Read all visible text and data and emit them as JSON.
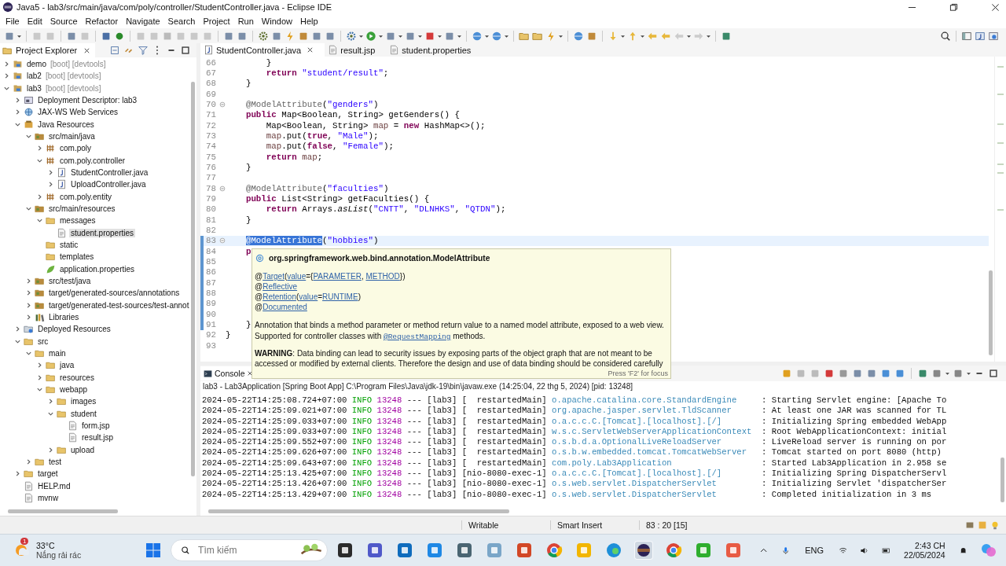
{
  "window": {
    "title": "Java5 - lab3/src/main/java/com/poly/controller/StudentController.java - Eclipse IDE"
  },
  "menu": [
    "File",
    "Edit",
    "Source",
    "Refactor",
    "Navigate",
    "Search",
    "Project",
    "Run",
    "Window",
    "Help"
  ],
  "project_explorer": {
    "title": "Project Explorer",
    "tree": [
      {
        "label": "demo",
        "suffix": "[boot] [devtools]",
        "kind": "project",
        "expanded": false,
        "selected": false
      },
      {
        "label": "lab2",
        "suffix": "[boot] [devtools]",
        "kind": "project",
        "expanded": false,
        "selected": false
      },
      {
        "label": "lab3",
        "suffix": "[boot] [devtools]",
        "kind": "project",
        "expanded": true,
        "selected": false,
        "children": [
          {
            "label": "Deployment Descriptor: lab3",
            "kind": "descriptor",
            "expanded": false,
            "selected": false
          },
          {
            "label": "JAX-WS Web Services",
            "kind": "webservice",
            "expanded": false,
            "selected": false
          },
          {
            "label": "Java Resources",
            "kind": "javares",
            "expanded": true,
            "selected": false,
            "children": [
              {
                "label": "src/main/java",
                "kind": "srcfolder",
                "expanded": true,
                "selected": false,
                "children": [
                  {
                    "label": "com.poly",
                    "kind": "package",
                    "expanded": false,
                    "selected": false
                  },
                  {
                    "label": "com.poly.controller",
                    "kind": "package",
                    "expanded": true,
                    "selected": false,
                    "children": [
                      {
                        "label": "StudentController.java",
                        "kind": "javafile",
                        "expanded": false,
                        "selected": false
                      },
                      {
                        "label": "UploadController.java",
                        "kind": "javafile",
                        "expanded": false,
                        "selected": false
                      }
                    ]
                  },
                  {
                    "label": "com.poly.entity",
                    "kind": "package",
                    "expanded": false,
                    "selected": false
                  }
                ]
              },
              {
                "label": "src/main/resources",
                "kind": "srcfolder",
                "expanded": true,
                "selected": false,
                "children": [
                  {
                    "label": "messages",
                    "kind": "folder",
                    "expanded": true,
                    "selected": false,
                    "children": [
                      {
                        "label": "student.properties",
                        "kind": "file",
                        "selected": true
                      }
                    ]
                  },
                  {
                    "label": "static",
                    "kind": "folder",
                    "selected": false
                  },
                  {
                    "label": "templates",
                    "kind": "folder",
                    "selected": false
                  },
                  {
                    "label": "application.properties",
                    "kind": "spring",
                    "selected": false
                  }
                ]
              },
              {
                "label": "src/test/java",
                "kind": "srcfolder",
                "expanded": false,
                "selected": false
              },
              {
                "label": "target/generated-sources/annotations",
                "kind": "srcfolder",
                "expanded": false,
                "selected": false
              },
              {
                "label": "target/generated-test-sources/test-annot",
                "kind": "srcfolder",
                "expanded": false,
                "selected": false
              },
              {
                "label": "Libraries",
                "kind": "library",
                "expanded": false,
                "selected": false
              }
            ]
          },
          {
            "label": "Deployed Resources",
            "kind": "deployed",
            "expanded": false,
            "selected": false
          },
          {
            "label": "src",
            "kind": "folder",
            "expanded": true,
            "selected": false,
            "children": [
              {
                "label": "main",
                "kind": "folder",
                "expanded": true,
                "selected": false,
                "children": [
                  {
                    "label": "java",
                    "kind": "folder",
                    "expanded": false,
                    "selected": false
                  },
                  {
                    "label": "resources",
                    "kind": "folder",
                    "expanded": false,
                    "selected": false
                  },
                  {
                    "label": "webapp",
                    "kind": "folder",
                    "expanded": true,
                    "selected": false,
                    "children": [
                      {
                        "label": "images",
                        "kind": "folder",
                        "expanded": false,
                        "selected": false
                      },
                      {
                        "label": "student",
                        "kind": "folder",
                        "expanded": true,
                        "selected": false,
                        "children": [
                          {
                            "label": "form.jsp",
                            "kind": "jsp",
                            "selected": false
                          },
                          {
                            "label": "result.jsp",
                            "kind": "jsp",
                            "selected": false
                          }
                        ]
                      },
                      {
                        "label": "upload",
                        "kind": "folder",
                        "expanded": false,
                        "selected": false
                      }
                    ]
                  }
                ]
              },
              {
                "label": "test",
                "kind": "folder",
                "expanded": false,
                "selected": false
              }
            ]
          },
          {
            "label": "target",
            "kind": "folder",
            "expanded": false,
            "selected": false
          },
          {
            "label": "HELP.md",
            "kind": "md",
            "selected": false
          },
          {
            "label": "mvnw",
            "kind": "file",
            "selected": false
          }
        ]
      }
    ]
  },
  "editor": {
    "tabs": [
      {
        "label": "StudentController.java",
        "kind": "javafile",
        "selected": true
      },
      {
        "label": "result.jsp",
        "kind": "jsp",
        "selected": false
      },
      {
        "label": "student.properties",
        "kind": "file",
        "selected": false
      }
    ],
    "lines": [
      {
        "number": "66",
        "kind": "body",
        "fold": false,
        "current": false,
        "in_range": false,
        "tokens": [
          {
            "kind": "plain",
            "text": "}"
          }
        ]
      },
      {
        "number": "67",
        "kind": "body",
        "fold": false,
        "current": false,
        "in_range": false,
        "tokens": [
          {
            "kind": "keyword",
            "text": "return "
          },
          {
            "kind": "string",
            "text": "\"student/result\""
          },
          {
            "kind": "plain",
            "text": ";"
          }
        ]
      },
      {
        "number": "68",
        "kind": "member",
        "fold": false,
        "current": false,
        "in_range": false,
        "tokens": [
          {
            "kind": "plain",
            "text": "}"
          }
        ]
      },
      {
        "number": "69",
        "fold": false,
        "current": false,
        "in_range": false
      },
      {
        "number": "70",
        "kind": "member",
        "fold": true,
        "current": false,
        "in_range": false,
        "tokens": [
          {
            "kind": "annotation",
            "text": "@ModelAttribute"
          },
          {
            "kind": "plain",
            "text": "("
          },
          {
            "kind": "string",
            "text": "\"genders\""
          },
          {
            "kind": "plain",
            "text": ")"
          }
        ]
      },
      {
        "number": "71",
        "kind": "member",
        "fold": false,
        "current": false,
        "in_range": false,
        "tokens": [
          {
            "kind": "keyword",
            "text": "public"
          },
          {
            "kind": "plain",
            "text": " Map<Boolean, String> getGenders() {"
          }
        ]
      },
      {
        "number": "72",
        "kind": "body",
        "fold": false,
        "current": false,
        "in_range": false,
        "tokens": [
          {
            "kind": "plain",
            "text": "Map<Boolean, String> "
          },
          {
            "kind": "variable",
            "text": "map"
          },
          {
            "kind": "plain",
            "text": " = "
          },
          {
            "kind": "keyword",
            "text": "new"
          },
          {
            "kind": "plain",
            "text": " HashMap<>();"
          }
        ]
      },
      {
        "number": "73",
        "kind": "body",
        "fold": false,
        "current": false,
        "in_range": false,
        "tokens": [
          {
            "kind": "variable",
            "text": "map"
          },
          {
            "kind": "plain",
            "text": ".put("
          },
          {
            "kind": "keyword",
            "text": "true"
          },
          {
            "kind": "plain",
            "text": ", "
          },
          {
            "kind": "string",
            "text": "\"Male\""
          },
          {
            "kind": "plain",
            "text": ");"
          }
        ]
      },
      {
        "number": "74",
        "kind": "body",
        "fold": false,
        "current": false,
        "in_range": false,
        "tokens": [
          {
            "kind": "variable",
            "text": "map"
          },
          {
            "kind": "plain",
            "text": ".put("
          },
          {
            "kind": "keyword",
            "text": "false"
          },
          {
            "kind": "plain",
            "text": ", "
          },
          {
            "kind": "string",
            "text": "\"Female\""
          },
          {
            "kind": "plain",
            "text": ");"
          }
        ]
      },
      {
        "number": "75",
        "kind": "body",
        "fold": false,
        "current": false,
        "in_range": false,
        "tokens": [
          {
            "kind": "keyword",
            "text": "return "
          },
          {
            "kind": "variable",
            "text": "map"
          },
          {
            "kind": "plain",
            "text": ";"
          }
        ]
      },
      {
        "number": "76",
        "kind": "member",
        "fold": false,
        "current": false,
        "in_range": false,
        "tokens": [
          {
            "kind": "plain",
            "text": "}"
          }
        ]
      },
      {
        "number": "77",
        "fold": false,
        "current": false,
        "in_range": false
      },
      {
        "number": "78",
        "kind": "member",
        "fold": true,
        "current": false,
        "in_range": false,
        "tokens": [
          {
            "kind": "annotation",
            "text": "@ModelAttribute"
          },
          {
            "kind": "plain",
            "text": "("
          },
          {
            "kind": "string",
            "text": "\"faculties\""
          },
          {
            "kind": "plain",
            "text": ")"
          }
        ]
      },
      {
        "number": "79",
        "kind": "member",
        "fold": false,
        "current": false,
        "in_range": false,
        "tokens": [
          {
            "kind": "keyword",
            "text": "public"
          },
          {
            "kind": "plain",
            "text": " List<String> getFaculties() {"
          }
        ]
      },
      {
        "number": "80",
        "kind": "body",
        "fold": false,
        "current": false,
        "in_range": false,
        "tokens": [
          {
            "kind": "keyword",
            "text": "return "
          },
          {
            "kind": "plain",
            "text": "Arrays."
          },
          {
            "kind": "static",
            "text": "asList"
          },
          {
            "kind": "plain",
            "text": "("
          },
          {
            "kind": "string",
            "text": "\"CNTT\""
          },
          {
            "kind": "plain",
            "text": ", "
          },
          {
            "kind": "string",
            "text": "\"DLNHKS\""
          },
          {
            "kind": "plain",
            "text": ", "
          },
          {
            "kind": "string",
            "text": "\"QTDN\""
          },
          {
            "kind": "plain",
            "text": ");"
          }
        ]
      },
      {
        "number": "81",
        "kind": "member",
        "fold": false,
        "current": false,
        "in_range": false,
        "tokens": [
          {
            "kind": "plain",
            "text": "}"
          }
        ]
      },
      {
        "number": "82",
        "fold": false,
        "current": false,
        "in_range": false
      },
      {
        "number": "83",
        "kind": "member",
        "fold": true,
        "current": true,
        "in_range": true,
        "tokens": [
          {
            "kind": "selection",
            "text": "@ModelAttribute"
          },
          {
            "kind": "plain",
            "text": "("
          },
          {
            "kind": "string",
            "text": "\"hobbies\""
          },
          {
            "kind": "plain",
            "text": ")"
          }
        ]
      },
      {
        "number": "84",
        "kind": "member",
        "fold": false,
        "current": false,
        "in_range": true,
        "tokens": [
          {
            "kind": "keyword",
            "text": "p"
          }
        ]
      },
      {
        "number": "85",
        "fold": false,
        "current": false,
        "in_range": true
      },
      {
        "number": "86",
        "fold": false,
        "current": false,
        "in_range": true
      },
      {
        "number": "87",
        "fold": false,
        "current": false,
        "in_range": true
      },
      {
        "number": "88",
        "fold": false,
        "current": false,
        "in_range": true
      },
      {
        "number": "89",
        "fold": false,
        "current": false,
        "in_range": true
      },
      {
        "number": "90",
        "fold": false,
        "current": false,
        "in_range": true
      },
      {
        "number": "91",
        "kind": "member",
        "fold": false,
        "current": false,
        "in_range": true,
        "tokens": [
          {
            "kind": "plain",
            "text": "}"
          }
        ]
      },
      {
        "number": "92",
        "kind": "top",
        "fold": false,
        "current": false,
        "in_range": false,
        "tokens": [
          {
            "kind": "plain",
            "text": "}"
          }
        ]
      },
      {
        "number": "93",
        "fold": false,
        "current": false,
        "in_range": false
      }
    ],
    "hover": {
      "title": "org.springframework.web.bind.annotation.ModelAttribute",
      "meta": [
        [
          {
            "kind": "text",
            "text": "@"
          },
          {
            "kind": "link",
            "text": "Target"
          },
          {
            "kind": "text",
            "text": "("
          },
          {
            "kind": "link",
            "text": "value"
          },
          {
            "kind": "text",
            "text": "={"
          },
          {
            "kind": "link",
            "text": "PARAMETER"
          },
          {
            "kind": "text",
            "text": ", "
          },
          {
            "kind": "link",
            "text": "METHOD"
          },
          {
            "kind": "text",
            "text": "})"
          }
        ],
        [
          {
            "kind": "text",
            "text": "@"
          },
          {
            "kind": "link",
            "text": "Reflective"
          }
        ],
        [
          {
            "kind": "text",
            "text": "@"
          },
          {
            "kind": "link",
            "text": "Retention"
          },
          {
            "kind": "text",
            "text": "("
          },
          {
            "kind": "link",
            "text": "value"
          },
          {
            "kind": "text",
            "text": "="
          },
          {
            "kind": "link",
            "text": "RUNTIME"
          },
          {
            "kind": "text",
            "text": ")"
          }
        ],
        [
          {
            "kind": "text",
            "text": "@"
          },
          {
            "kind": "link",
            "text": "Documented"
          }
        ]
      ],
      "description": [
        {
          "kind": "text",
          "text": "Annotation that binds a method parameter or method return value to a named model attribute, exposed to a web view. Supported for controller classes with "
        },
        {
          "kind": "code_link",
          "text": "@RequestMapping"
        },
        {
          "kind": "text",
          "text": " methods."
        }
      ],
      "warning": "**WARNING**: Data binding can lead to security issues by exposing parts of the object graph that are not meant to be accessed or modified by external clients. Therefore the design and use of data binding should be considered carefully",
      "footer": "Press 'F2' for focus"
    }
  },
  "console": {
    "tab": "Console",
    "header": "lab3 - Lab3Application [Spring Boot App] C:\\Program Files\\Java\\jdk-19\\bin\\javaw.exe  (14:25:04, 22 thg 5, 2024) [pid: 13248]",
    "lines": [
      {
        "time": "2024-05-22T14:25:08.724+07:00",
        "level": "INFO",
        "pid": "13248",
        "sep": "---",
        "app": "[lab3]",
        "thread": "[  restartedMain]",
        "logger": "o.apache.catalina.core.StandardEngine",
        "message": ": Starting Servlet engine: [Apache To"
      },
      {
        "time": "2024-05-22T14:25:09.021+07:00",
        "level": "INFO",
        "pid": "13248",
        "sep": "---",
        "app": "[lab3]",
        "thread": "[  restartedMain]",
        "logger": "org.apache.jasper.servlet.TldScanner",
        "message": ": At least one JAR was scanned for TL"
      },
      {
        "time": "2024-05-22T14:25:09.033+07:00",
        "level": "INFO",
        "pid": "13248",
        "sep": "---",
        "app": "[lab3]",
        "thread": "[  restartedMain]",
        "logger": "o.a.c.c.C.[Tomcat].[localhost].[/]",
        "message": ": Initializing Spring embedded WebApp"
      },
      {
        "time": "2024-05-22T14:25:09.033+07:00",
        "level": "INFO",
        "pid": "13248",
        "sep": "---",
        "app": "[lab3]",
        "thread": "[  restartedMain]",
        "logger": "w.s.c.ServletWebServerApplicationContext",
        "message": ": Root WebApplicationContext: initial"
      },
      {
        "time": "2024-05-22T14:25:09.552+07:00",
        "level": "INFO",
        "pid": "13248",
        "sep": "---",
        "app": "[lab3]",
        "thread": "[  restartedMain]",
        "logger": "o.s.b.d.a.OptionalLiveReloadServer",
        "message": ": LiveReload server is running on por"
      },
      {
        "time": "2024-05-22T14:25:09.626+07:00",
        "level": "INFO",
        "pid": "13248",
        "sep": "---",
        "app": "[lab3]",
        "thread": "[  restartedMain]",
        "logger": "o.s.b.w.embedded.tomcat.TomcatWebServer",
        "message": ": Tomcat started on port 8080 (http)"
      },
      {
        "time": "2024-05-22T14:25:09.643+07:00",
        "level": "INFO",
        "pid": "13248",
        "sep": "---",
        "app": "[lab3]",
        "thread": "[  restartedMain]",
        "logger": "com.poly.Lab3Application",
        "message": ": Started Lab3Application in 2.958 se"
      },
      {
        "time": "2024-05-22T14:25:13.425+07:00",
        "level": "INFO",
        "pid": "13248",
        "sep": "---",
        "app": "[lab3]",
        "thread": "[nio-8080-exec-1]",
        "logger": "o.a.c.c.C.[Tomcat].[localhost].[/]",
        "message": ": Initializing Spring DispatcherServl"
      },
      {
        "time": "2024-05-22T14:25:13.426+07:00",
        "level": "INFO",
        "pid": "13248",
        "sep": "---",
        "app": "[lab3]",
        "thread": "[nio-8080-exec-1]",
        "logger": "o.s.web.servlet.DispatcherServlet",
        "message": ": Initializing Servlet 'dispatcherSer"
      },
      {
        "time": "2024-05-22T14:25:13.429+07:00",
        "level": "INFO",
        "pid": "13248",
        "sep": "---",
        "app": "[lab3]",
        "thread": "[nio-8080-exec-1]",
        "logger": "o.s.web.servlet.DispatcherServlet",
        "message": ": Completed initialization in 3 ms"
      }
    ]
  },
  "status_bar": [
    "Writable",
    "Smart Insert",
    "83 : 20 [15]"
  ],
  "taskbar": {
    "badge": "1",
    "temperature": "33°C",
    "weather": "Nắng rải rác",
    "search": {
      "placeholder": "Tìm kiếm"
    },
    "language": "ENG",
    "time": "2:43 CH",
    "date": "22/05/2024"
  }
}
